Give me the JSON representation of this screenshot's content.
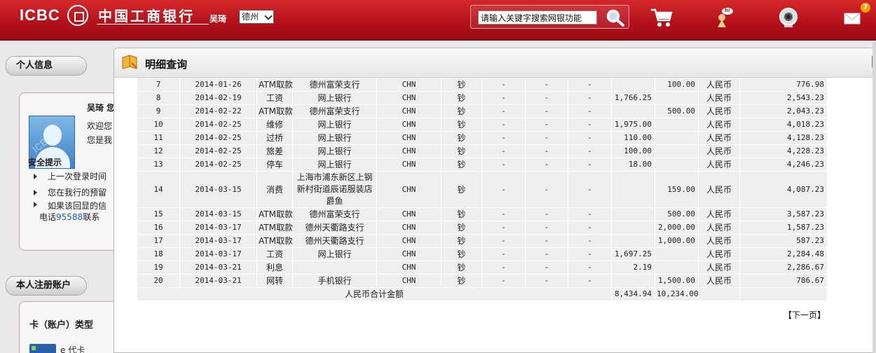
{
  "header": {
    "logo_text": "ICBC",
    "logo_cn": "中国工商银行",
    "user_name": "吴琦",
    "city": "德州",
    "search_placeholder": "请输入关键字搜索网银功能",
    "mail_badge": "7",
    "mascot_badge": "hi"
  },
  "sidebar": {
    "personal_tab": "个人信息",
    "user_label": "吴琦",
    "user_label_suffix": "您",
    "welcome_1": "欢迎您",
    "welcome_2": "您是我",
    "security_title": "安全提示",
    "tips": [
      "上一次登录时间",
      "您在我行的预留",
      "如果该回显的信"
    ],
    "tip_phone_prefix": "电话",
    "tip_phone": "95588",
    "tip_phone_suffix": "联系",
    "accounts_tab": "本人注册账户",
    "card_type_label": "卡（账户）类型",
    "card_item_label": "e 代卡"
  },
  "main": {
    "title": "明细查询",
    "next_page": "【下一页】",
    "total_label": "人民币合计金额",
    "total_income": "8,434.94",
    "total_expense": "10,234.00",
    "rows": [
      {
        "no": "7",
        "date": "2014-01-26",
        "summary": "ATM取款",
        "place": "德州富荣支行",
        "country": "CHN",
        "cash": "钞",
        "c7": "-",
        "c8": "-",
        "c9": "-",
        "income": "",
        "expense": "100.00",
        "currency": "人民币",
        "balance": "776.98"
      },
      {
        "no": "8",
        "date": "2014-02-19",
        "summary": "工资",
        "place": "网上银行",
        "country": "CHN",
        "cash": "钞",
        "c7": "-",
        "c8": "-",
        "c9": "-",
        "income": "1,766.25",
        "expense": "",
        "currency": "人民币",
        "balance": "2,543.23"
      },
      {
        "no": "9",
        "date": "2014-02-22",
        "summary": "ATM取款",
        "place": "德州富荣支行",
        "country": "CHN",
        "cash": "钞",
        "c7": "-",
        "c8": "-",
        "c9": "-",
        "income": "",
        "expense": "500.00",
        "currency": "人民币",
        "balance": "2,043.23"
      },
      {
        "no": "10",
        "date": "2014-02-25",
        "summary": "维修",
        "place": "网上银行",
        "country": "CHN",
        "cash": "钞",
        "c7": "-",
        "c8": "-",
        "c9": "-",
        "income": "1,975.00",
        "expense": "",
        "currency": "人民币",
        "balance": "4,018.23"
      },
      {
        "no": "11",
        "date": "2014-02-25",
        "summary": "过桥",
        "place": "网上银行",
        "country": "CHN",
        "cash": "钞",
        "c7": "-",
        "c8": "-",
        "c9": "-",
        "income": "110.00",
        "expense": "",
        "currency": "人民币",
        "balance": "4,128.23"
      },
      {
        "no": "12",
        "date": "2014-02-25",
        "summary": "旅差",
        "place": "网上银行",
        "country": "CHN",
        "cash": "钞",
        "c7": "-",
        "c8": "-",
        "c9": "-",
        "income": "100.00",
        "expense": "",
        "currency": "人民币",
        "balance": "4,228.23"
      },
      {
        "no": "13",
        "date": "2014-02-25",
        "summary": "停车",
        "place": "网上银行",
        "country": "CHN",
        "cash": "钞",
        "c7": "-",
        "c8": "-",
        "c9": "-",
        "income": "18.00",
        "expense": "",
        "currency": "人民币",
        "balance": "4,246.23"
      },
      {
        "no": "14",
        "date": "2014-03-15",
        "summary": "消费",
        "place": "上海市浦东新区上钢新村街道辰诺服装店 爵鱼",
        "country": "CHN",
        "cash": "钞",
        "c7": "-",
        "c8": "-",
        "c9": "-",
        "income": "",
        "expense": "159.00",
        "currency": "人民币",
        "balance": "4,087.23"
      },
      {
        "no": "15",
        "date": "2014-03-15",
        "summary": "ATM取款",
        "place": "德州富荣支行",
        "country": "CHN",
        "cash": "钞",
        "c7": "-",
        "c8": "-",
        "c9": "-",
        "income": "",
        "expense": "500.00",
        "currency": "人民币",
        "balance": "3,587.23"
      },
      {
        "no": "16",
        "date": "2014-03-17",
        "summary": "ATM取款",
        "place": "德州天衢路支行",
        "country": "CHN",
        "cash": "钞",
        "c7": "-",
        "c8": "-",
        "c9": "-",
        "income": "",
        "expense": "2,000.00",
        "currency": "人民币",
        "balance": "1,587.23"
      },
      {
        "no": "17",
        "date": "2014-03-17",
        "summary": "ATM取款",
        "place": "德州天衢路支行",
        "country": "CHN",
        "cash": "钞",
        "c7": "-",
        "c8": "-",
        "c9": "-",
        "income": "",
        "expense": "1,000.00",
        "currency": "人民币",
        "balance": "587.23"
      },
      {
        "no": "18",
        "date": "2014-03-17",
        "summary": "工资",
        "place": "网上银行",
        "country": "CHN",
        "cash": "钞",
        "c7": "-",
        "c8": "-",
        "c9": "-",
        "income": "1,697.25",
        "expense": "",
        "currency": "人民币",
        "balance": "2,284.48"
      },
      {
        "no": "19",
        "date": "2014-03-21",
        "summary": "利息",
        "place": "",
        "country": "CHN",
        "cash": "钞",
        "c7": "-",
        "c8": "-",
        "c9": "-",
        "income": "2.19",
        "expense": "",
        "currency": "人民币",
        "balance": "2,286.67"
      },
      {
        "no": "20",
        "date": "2014-03-21",
        "summary": "网转",
        "place": "手机银行",
        "country": "CHN",
        "cash": "钞",
        "c7": "-",
        "c8": "-",
        "c9": "-",
        "income": "",
        "expense": "1,500.00",
        "currency": "人民币",
        "balance": "786.67"
      }
    ]
  },
  "colors": {
    "brand_red": "#c41a22",
    "badge_orange": "#f4a000",
    "phone_blue": "#1e5aa8"
  }
}
